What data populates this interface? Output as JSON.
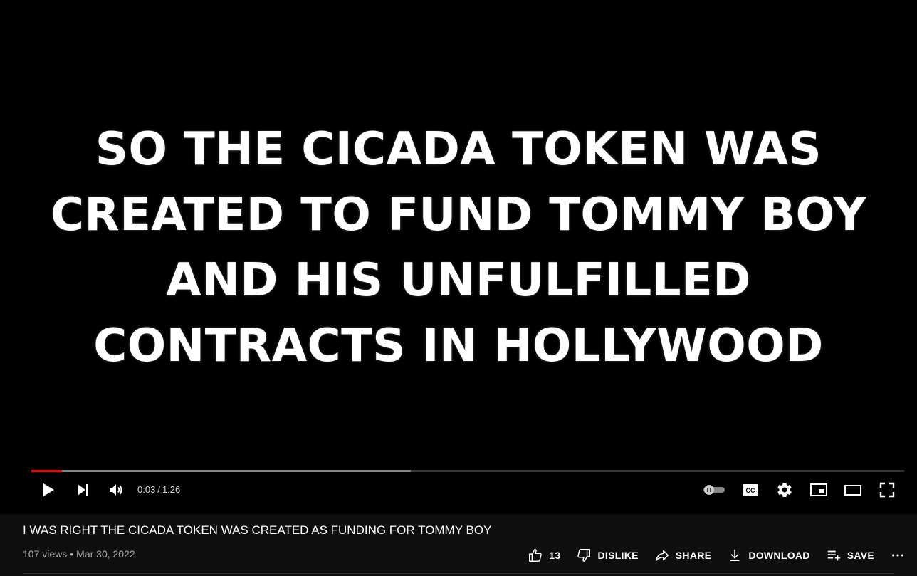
{
  "video": {
    "caption_lines": [
      "SO THE CICADA TOKEN WAS",
      "CREATED TO FUND TOMMY BOY",
      "AND HIS UNFULFILLED",
      "CONTRACTS IN HOLLYWOOD"
    ],
    "progress_played_fraction": 0.035,
    "progress_buffered_fraction": 0.435
  },
  "player": {
    "time_current": "0:03",
    "time_separator": "/",
    "time_total": "1:26"
  },
  "info": {
    "title": "I WAS RIGHT THE CICADA TOKEN WAS CREATED AS FUNDING FOR TOMMY BOY",
    "views": "107 views",
    "dot": "•",
    "date": "Mar 30, 2022"
  },
  "actions": {
    "like_count": "13",
    "dislike_label": "DISLIKE",
    "share_label": "SHARE",
    "download_label": "DOWNLOAD",
    "save_label": "SAVE"
  },
  "colors": {
    "progress_played": "#ff0000",
    "background": "#0f0f0f",
    "player_background": "#000000"
  }
}
